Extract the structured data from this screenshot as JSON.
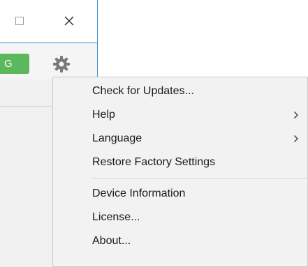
{
  "window": {
    "accent_color": "#3c8bd4",
    "green_button_label": "G"
  },
  "menu": {
    "items_top": [
      {
        "label": "Check for Updates...",
        "submenu": false
      },
      {
        "label": "Help",
        "submenu": true
      },
      {
        "label": "Language",
        "submenu": true
      },
      {
        "label": "Restore Factory Settings",
        "submenu": false
      }
    ],
    "items_bottom": [
      {
        "label": "Device Information",
        "submenu": false
      },
      {
        "label": "License...",
        "submenu": false
      },
      {
        "label": "About...",
        "submenu": false
      }
    ],
    "icons": {
      "maximize": "maximize-icon",
      "close": "close-icon",
      "gear": "gear-icon",
      "submenu_arrow": "chevron-right-icon"
    }
  }
}
